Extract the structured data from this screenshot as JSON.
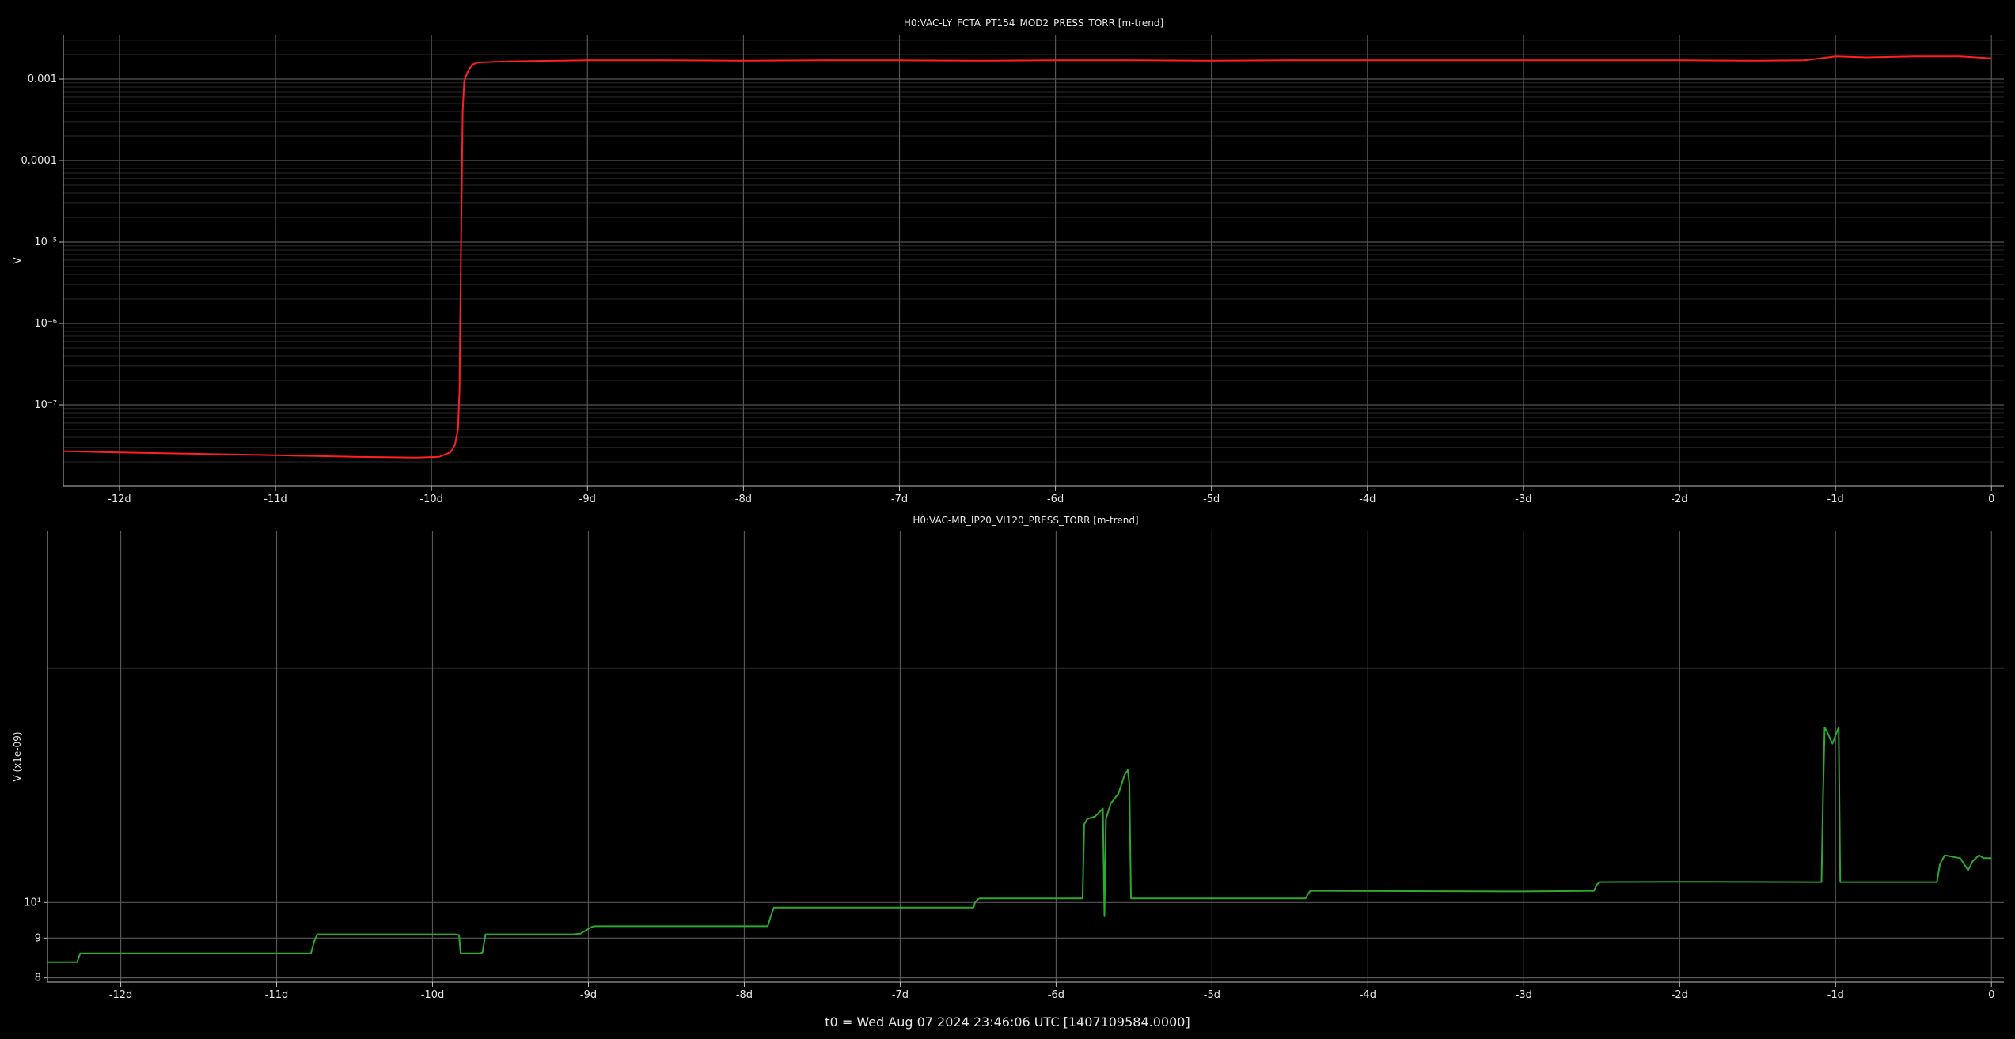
{
  "colors": {
    "background": "#000000",
    "axis": "#bbbbbb",
    "grid_major": "#555555",
    "grid_minor": "#2a2a2a",
    "text": "#e6e6e6"
  },
  "footer": "t0 = Wed Aug 07 2024 23:46:06 UTC [1407109584.0000]",
  "chart_data": [
    {
      "type": "line",
      "title": "H0:VAC-LY_FCTA_PT154_MOD2_PRESS_TORR [m-trend]",
      "ylabel": "V",
      "xlabel": "",
      "y_scale": "log",
      "grid": true,
      "color": "#ff2020",
      "xlim": [
        -12.36,
        0.08
      ],
      "ylim": [
        1e-08,
        0.0035
      ],
      "x_ticks": [
        -12,
        -11,
        -10,
        -9,
        -8,
        -7,
        -6,
        -5,
        -4,
        -3,
        -2,
        -1,
        0
      ],
      "x_tick_labels": [
        "-12d",
        "-11d",
        "-10d",
        "-9d",
        "-8d",
        "-7d",
        "-6d",
        "-5d",
        "-4d",
        "-3d",
        "-2d",
        "-1d",
        "0"
      ],
      "y_ticks": [
        1e-07,
        1e-06,
        1e-05,
        0.0001,
        0.001
      ],
      "y_tick_labels": [
        "10⁻⁷",
        "10⁻⁶",
        "10⁻⁵",
        "0.0001",
        "0.001"
      ],
      "series": [
        {
          "x": [
            -12.36,
            -12.0,
            -11.5,
            -11.0,
            -10.5,
            -10.1,
            -9.95,
            -9.88,
            -9.85,
            -9.83,
            -9.82,
            -9.81,
            -9.8,
            -9.79,
            -9.77,
            -9.74,
            -9.7,
            -9.5,
            -9.0,
            -8.5,
            -8.0,
            -7.5,
            -7.0,
            -6.5,
            -6.0,
            -5.5,
            -5.0,
            -4.5,
            -4.0,
            -3.5,
            -3.0,
            -2.5,
            -2.0,
            -1.5,
            -1.2,
            -1.0,
            -0.8,
            -0.5,
            -0.2,
            0.0
          ],
          "y": [
            2.7e-08,
            2.6e-08,
            2.5e-08,
            2.4e-08,
            2.3e-08,
            2.25e-08,
            2.3e-08,
            2.6e-08,
            3.2e-08,
            5e-08,
            1.5e-07,
            1e-05,
            0.0004,
            0.00095,
            0.0012,
            0.0015,
            0.0016,
            0.00165,
            0.0017,
            0.0017,
            0.00168,
            0.0017,
            0.0017,
            0.00168,
            0.0017,
            0.0017,
            0.00168,
            0.0017,
            0.0017,
            0.0017,
            0.0017,
            0.0017,
            0.0017,
            0.00168,
            0.0017,
            0.0019,
            0.00185,
            0.0019,
            0.0019,
            0.0018
          ]
        }
      ]
    },
    {
      "type": "line",
      "title": "H0:VAC-MR_IP20_VI120_PRESS_TORR [m-trend]",
      "ylabel": "V (x1e-09)",
      "xlabel": "",
      "y_scale": "log",
      "grid": true,
      "color": "#2ea82e",
      "xlim": [
        -12.47,
        0.08
      ],
      "ylim": [
        7.9,
        30.0
      ],
      "x_ticks": [
        -12,
        -11,
        -10,
        -9,
        -8,
        -7,
        -6,
        -5,
        -4,
        -3,
        -2,
        -1,
        0
      ],
      "x_tick_labels": [
        "-12d",
        "-11d",
        "-10d",
        "-9d",
        "-8d",
        "-7d",
        "-6d",
        "-5d",
        "-4d",
        "-3d",
        "-2d",
        "-1d",
        "0"
      ],
      "y_ticks": [
        8,
        9,
        10
      ],
      "y_tick_labels": [
        "8",
        "9",
        "10¹"
      ],
      "series": [
        {
          "x": [
            -12.47,
            -12.28,
            -12.26,
            -11.0,
            -10.78,
            -10.76,
            -10.74,
            -10.72,
            -9.85,
            -9.83,
            -9.82,
            -9.7,
            -9.68,
            -9.66,
            -9.1,
            -9.05,
            -8.98,
            -8.96,
            -7.85,
            -7.83,
            -7.81,
            -7.78,
            -6.53,
            -6.52,
            -6.5,
            -6.49,
            -5.83,
            -5.82,
            -5.8,
            -5.75,
            -5.7,
            -5.69,
            -5.68,
            -5.65,
            -5.6,
            -5.56,
            -5.54,
            -5.53,
            -5.52,
            -5.51,
            -5.0,
            -4.4,
            -4.39,
            -4.37,
            -4.36,
            -3.0,
            -2.55,
            -2.53,
            -2.51,
            -2.0,
            -1.09,
            -1.08,
            -1.07,
            -1.05,
            -1.02,
            -0.98,
            -0.97,
            -0.96,
            -0.5,
            -0.35,
            -0.33,
            -0.3,
            -0.2,
            -0.15,
            -0.12,
            -0.08,
            -0.05,
            0.0
          ],
          "y": [
            8.38,
            8.38,
            8.6,
            8.6,
            8.6,
            8.9,
            9.1,
            9.1,
            9.1,
            9.08,
            8.6,
            8.6,
            8.62,
            9.1,
            9.1,
            9.12,
            9.3,
            9.32,
            9.32,
            9.6,
            9.85,
            9.85,
            9.85,
            10.0,
            10.1,
            10.12,
            10.12,
            12.6,
            12.8,
            12.9,
            13.2,
            9.6,
            12.8,
            13.4,
            13.8,
            14.6,
            14.8,
            14.2,
            10.12,
            10.12,
            10.12,
            10.12,
            10.2,
            10.35,
            10.35,
            10.33,
            10.35,
            10.55,
            10.62,
            10.63,
            10.62,
            13.8,
            16.8,
            16.5,
            16.0,
            16.8,
            10.62,
            10.62,
            10.62,
            10.62,
            11.2,
            11.5,
            11.4,
            11.0,
            11.3,
            11.5,
            11.4,
            11.4
          ]
        }
      ]
    }
  ]
}
